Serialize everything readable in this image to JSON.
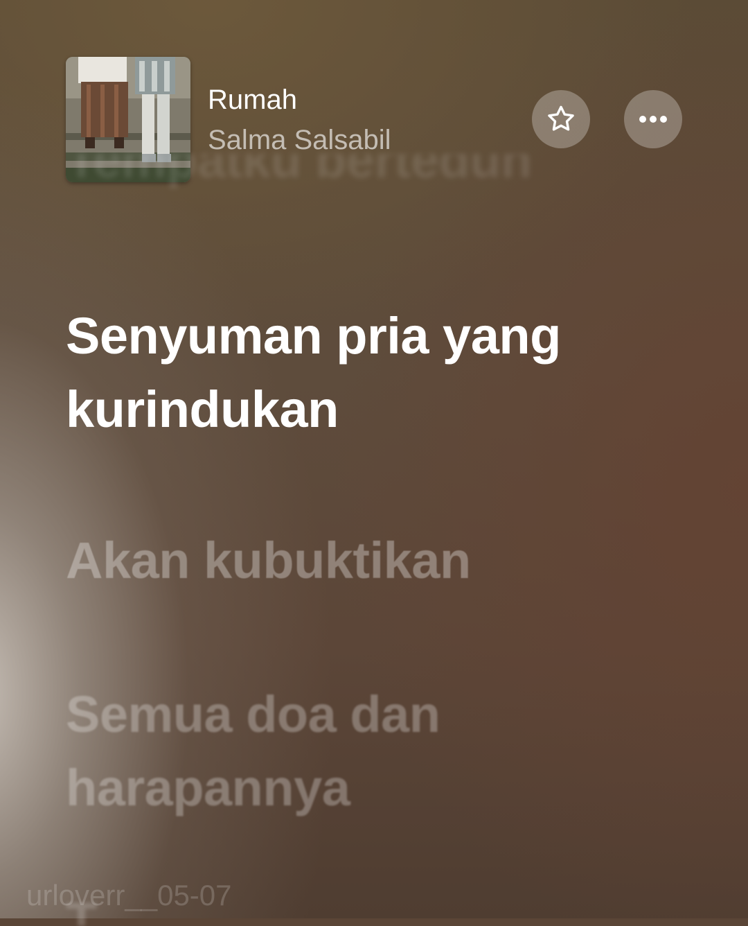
{
  "now_playing": {
    "title": "Rumah",
    "artist": "Salma Salsabil"
  },
  "buttons": {
    "favorite_icon": "star-outline-icon",
    "more_icon": "ellipsis-icon"
  },
  "lyrics": {
    "previous_line": "Tempatku berteduh",
    "current_line": "Senyuman pria yang kurindukan",
    "next_lines": [
      "Akan kubuktikan",
      "Semua doa dan harapannya",
      "T"
    ]
  },
  "watermark": "urloverr__05-07",
  "colors": {
    "active_lyric": "#ffffff",
    "inactive_lyric": "rgba(255,255,255,0.32)",
    "button_bg": "rgba(255,255,255,0.28)"
  }
}
